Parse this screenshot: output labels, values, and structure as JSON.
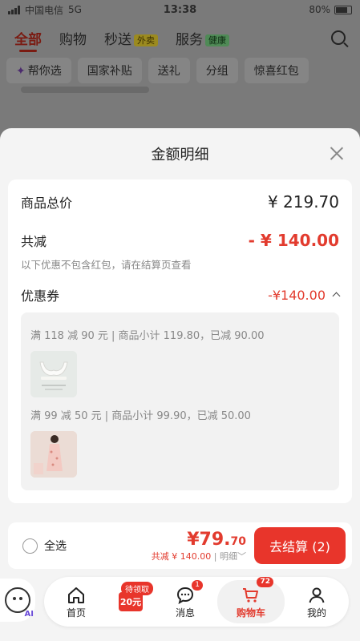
{
  "status_bar": {
    "carrier": "中国电信",
    "network": "5G",
    "time": "13:38",
    "battery": "80%"
  },
  "top_nav": {
    "tabs": [
      {
        "label": "全部"
      },
      {
        "label": "购物"
      },
      {
        "label": "秒送",
        "tag": "外卖"
      },
      {
        "label": "服务",
        "tag": "健康"
      }
    ]
  },
  "filter_chips": [
    "帮你选",
    "国家补贴",
    "送礼",
    "分组",
    "惊喜红包"
  ],
  "sheet": {
    "title": "金额明细",
    "total_label": "商品总价",
    "total_value": "¥ 219.70",
    "discount_label": "共减",
    "discount_value": "- ¥ 140.00",
    "discount_note": "以下优惠不包含红包，请在结算页查看",
    "coupon_label": "优惠券",
    "coupon_value": "-¥140.00",
    "coupon_details": [
      {
        "text": "满 118 减 90 元 | 商品小计 119.80，已减 90.00"
      },
      {
        "text": "满 99 减 50 元 | 商品小计 99.90，已减 50.00"
      }
    ]
  },
  "footer": {
    "select_all": "全选",
    "price_int": "¥79.",
    "price_dec": "70",
    "saved_text": "共减 ¥ 140.00",
    "detail_link": "明细",
    "checkout_label": "去结算 (2)"
  },
  "tab_bar": {
    "home": "首页",
    "coupon_pill": "待领取",
    "coupon_icon_text": "20元",
    "messages": "消息",
    "messages_badge": "1",
    "cart": "购物车",
    "cart_badge": "72",
    "mine": "我的"
  },
  "ai_label": "AI",
  "colors": {
    "accent": "#e8352b",
    "price_red": "#e23b2e"
  }
}
